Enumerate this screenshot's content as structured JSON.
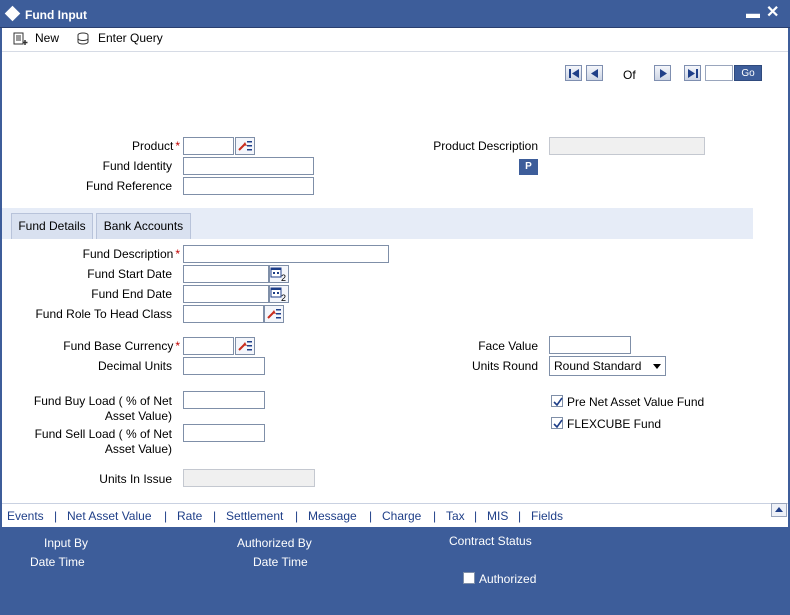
{
  "window": {
    "title": "Fund Input"
  },
  "toolbar": {
    "new_label": "New",
    "enter_query_label": "Enter Query"
  },
  "navigation": {
    "of_label": "Of",
    "go_label": "Go"
  },
  "header_fields": {
    "product_label": "Product",
    "fund_identity_label": "Fund Identity",
    "fund_reference_label": "Fund Reference",
    "product_description_label": "Product Description",
    "p_button_label": "P"
  },
  "tabs": [
    {
      "label": "Fund Details",
      "active": true
    },
    {
      "label": "Bank Accounts",
      "active": false
    }
  ],
  "fund_details": {
    "fund_description_label": "Fund Description",
    "fund_start_date_label": "Fund Start Date",
    "fund_end_date_label": "Fund End Date",
    "fund_role_label": "Fund Role To Head Class",
    "fund_base_currency_label": "Fund Base Currency",
    "decimal_units_label": "Decimal Units",
    "fund_buy_load_label_1": "Fund Buy Load ( % of Net",
    "fund_buy_load_label_2": "Asset Value)",
    "fund_sell_load_label_1": "Fund Sell Load ( % of Net",
    "fund_sell_load_label_2": "Asset Value)",
    "units_in_issue_label": "Units In Issue",
    "face_value_label": "Face Value",
    "units_round_label": "Units Round",
    "units_round_value": "Round Standard",
    "pre_nav_fund_label": "Pre Net Asset Value Fund",
    "pre_nav_fund_checked": true,
    "flexcube_fund_label": "FLEXCUBE Fund",
    "flexcube_fund_checked": true
  },
  "footer_links": [
    "Events",
    "Net Asset Value",
    "Rate",
    "Settlement",
    "Message",
    "Charge",
    "Tax",
    "MIS",
    "Fields"
  ],
  "audit": {
    "input_by_label": "Input By",
    "date_time_label_1": "Date Time",
    "authorized_by_label": "Authorized By",
    "date_time_label_2": "Date Time",
    "contract_status_label": "Contract Status",
    "authorized_label": "Authorized",
    "authorized_checked": false
  },
  "colors": {
    "titlebar": "#3d5d9a",
    "required": "#c00000",
    "link": "#1f3f88"
  }
}
